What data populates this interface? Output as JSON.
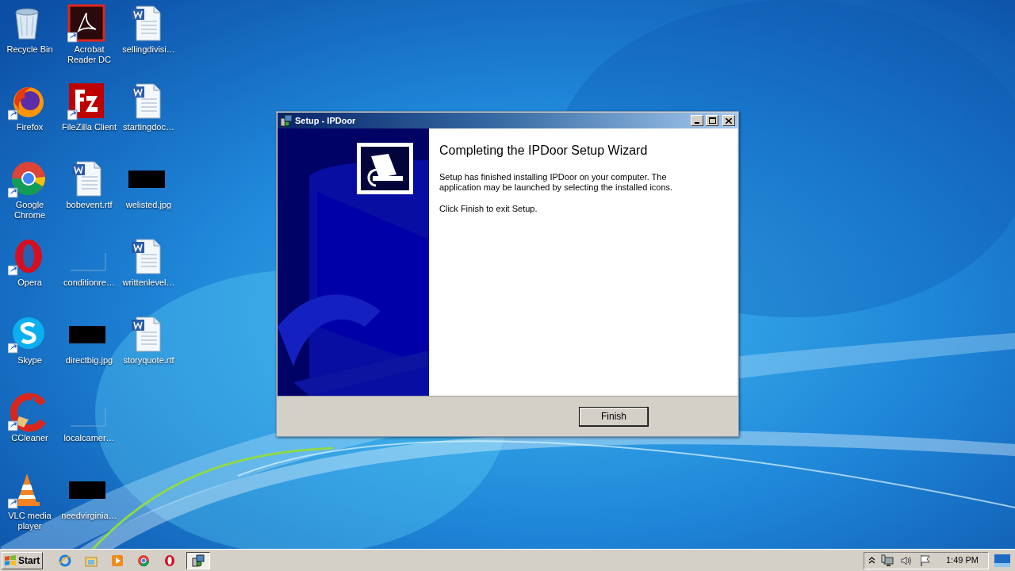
{
  "desktop_icons": [
    {
      "label": "Recycle Bin",
      "kind": "recycle",
      "shortcut": false
    },
    {
      "label": "Firefox",
      "kind": "firefox",
      "shortcut": true
    },
    {
      "label": "Google Chrome",
      "kind": "chrome",
      "shortcut": true
    },
    {
      "label": "Opera",
      "kind": "opera",
      "shortcut": true
    },
    {
      "label": "Skype",
      "kind": "skype",
      "shortcut": true
    },
    {
      "label": "CCleaner",
      "kind": "ccleaner",
      "shortcut": true
    },
    {
      "label": "VLC media player",
      "kind": "vlc",
      "shortcut": true
    },
    {
      "label": "Acrobat Reader DC",
      "kind": "acrobat",
      "shortcut": true
    },
    {
      "label": "FileZilla Client",
      "kind": "filezilla",
      "shortcut": true
    },
    {
      "label": "bobevent.rtf",
      "kind": "word",
      "shortcut": false
    },
    {
      "label": "conditionre…",
      "kind": "blank",
      "shortcut": false
    },
    {
      "label": "directbig.jpg",
      "kind": "image",
      "shortcut": false
    },
    {
      "label": "localcamer…",
      "kind": "blank",
      "shortcut": false
    },
    {
      "label": "needvirginia…",
      "kind": "image",
      "shortcut": false
    },
    {
      "label": "sellingdivisi…",
      "kind": "word",
      "shortcut": false
    },
    {
      "label": "startingdoc…",
      "kind": "word",
      "shortcut": false
    },
    {
      "label": "welisted.jpg",
      "kind": "image",
      "shortcut": false
    },
    {
      "label": "writtenlevel…",
      "kind": "word",
      "shortcut": false
    },
    {
      "label": "storyquote.rtf",
      "kind": "word",
      "shortcut": false
    }
  ],
  "window": {
    "title": "Setup - IPDoor",
    "heading": "Completing the IPDoor Setup Wizard",
    "paragraphs": [
      "Setup has finished installing IPDoor on your computer. The application may be launched by selecting the installed icons.",
      "Click Finish to exit Setup."
    ],
    "buttons": [
      "Finish"
    ]
  },
  "taskbar": {
    "start_label": "Start",
    "items": [
      {
        "kind": "ie",
        "selected": false
      },
      {
        "kind": "explorer",
        "selected": false
      },
      {
        "kind": "media",
        "selected": false
      },
      {
        "kind": "chrome",
        "selected": false
      },
      {
        "kind": "opera",
        "selected": false
      },
      {
        "kind": "setup",
        "selected": true
      }
    ],
    "clock": "1:49 PM"
  }
}
